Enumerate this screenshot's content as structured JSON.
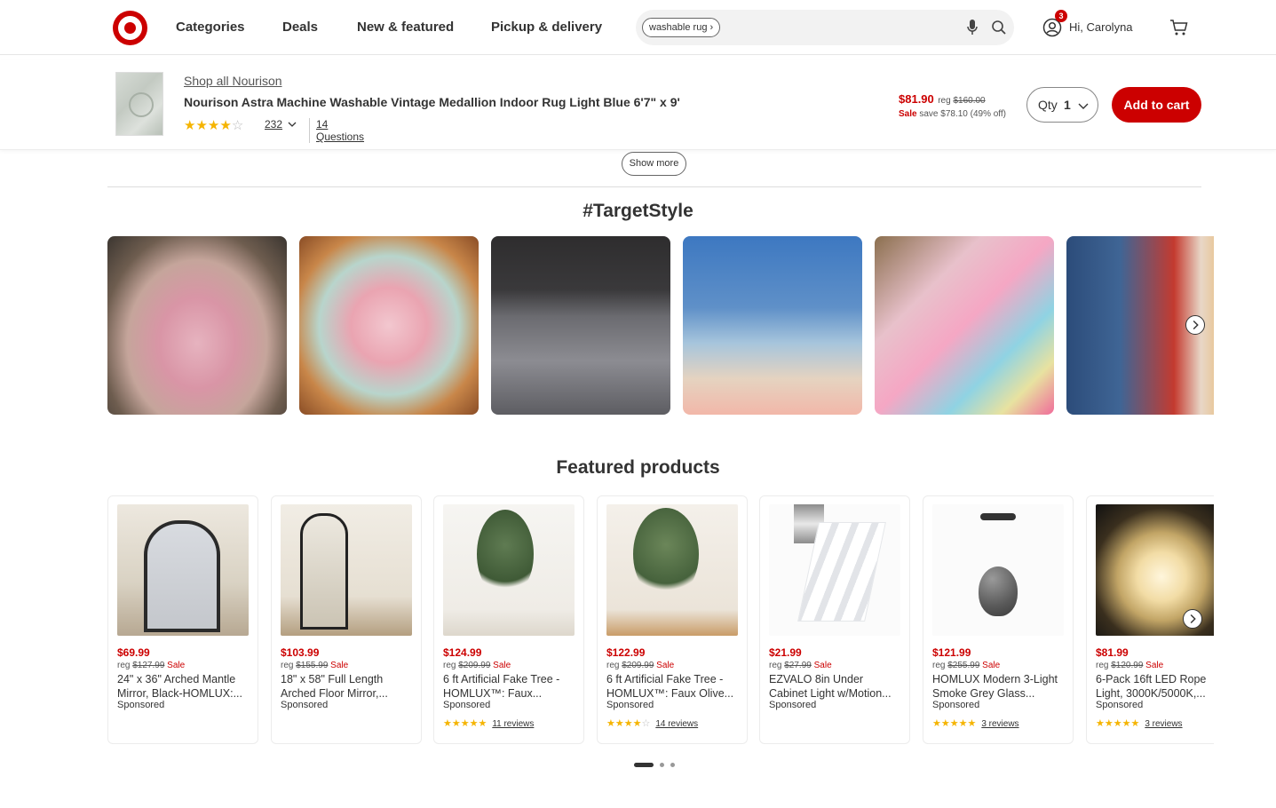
{
  "header": {
    "nav": [
      "Categories",
      "Deals",
      "New & featured",
      "Pickup & delivery"
    ],
    "search_chip": "washable rug",
    "account_badge": "3",
    "account_name": "Hi, Carolyna"
  },
  "sticky": {
    "shop_link": "Shop all Nourison",
    "product_title": "Nourison Astra Machine Washable Vintage Medallion Indoor Rug Light Blue 6'7\" x 9'",
    "rating_count": "232",
    "questions": "14 Questions",
    "price": "$81.90",
    "reg_label": "reg",
    "reg_price": "$160.00",
    "sale_label": "Sale",
    "save_text": "save $78.10 (49% off)",
    "qty_label": "Qty",
    "qty_value": "1",
    "add_to_cart": "Add to cart"
  },
  "show_more": "Show more",
  "target_style": {
    "title": "#TargetStyle"
  },
  "featured": {
    "title": "Featured products",
    "products": [
      {
        "price": "$69.99",
        "reg": "$127.99",
        "title": "24\" x 36\" Arched Mantle Mirror, Black-HOMLUX:...",
        "sponsored": "Sponsored",
        "reviews": ""
      },
      {
        "price": "$103.99",
        "reg": "$155.99",
        "title": "18\" x 58\" Full Length Arched Floor Mirror,...",
        "sponsored": "Sponsored",
        "reviews": ""
      },
      {
        "price": "$124.99",
        "reg": "$209.99",
        "title": "6 ft Artificial Fake Tree - HOMLUX™: Faux...",
        "sponsored": "Sponsored",
        "reviews": "11 reviews"
      },
      {
        "price": "$122.99",
        "reg": "$209.99",
        "title": "6 ft Artificial Fake Tree - HOMLUX™: Faux Olive...",
        "sponsored": "Sponsored",
        "reviews": "14 reviews"
      },
      {
        "price": "$21.99",
        "reg": "$27.99",
        "title": "EZVALO 8in Under Cabinet Light w/Motion...",
        "sponsored": "Sponsored",
        "reviews": ""
      },
      {
        "price": "$121.99",
        "reg": "$255.99",
        "title": "HOMLUX Modern 3-Light Smoke Grey Glass...",
        "sponsored": "Sponsored",
        "reviews": "3 reviews"
      },
      {
        "price": "$81.99",
        "reg": "$120.99",
        "title": "6-Pack 16ft LED Rope Light, 3000K/5000K,...",
        "sponsored": "Sponsored",
        "reviews": "3 reviews"
      }
    ],
    "reg_label": "reg",
    "sale_label": "Sale"
  },
  "colors": {
    "brand": "#cc0000"
  }
}
